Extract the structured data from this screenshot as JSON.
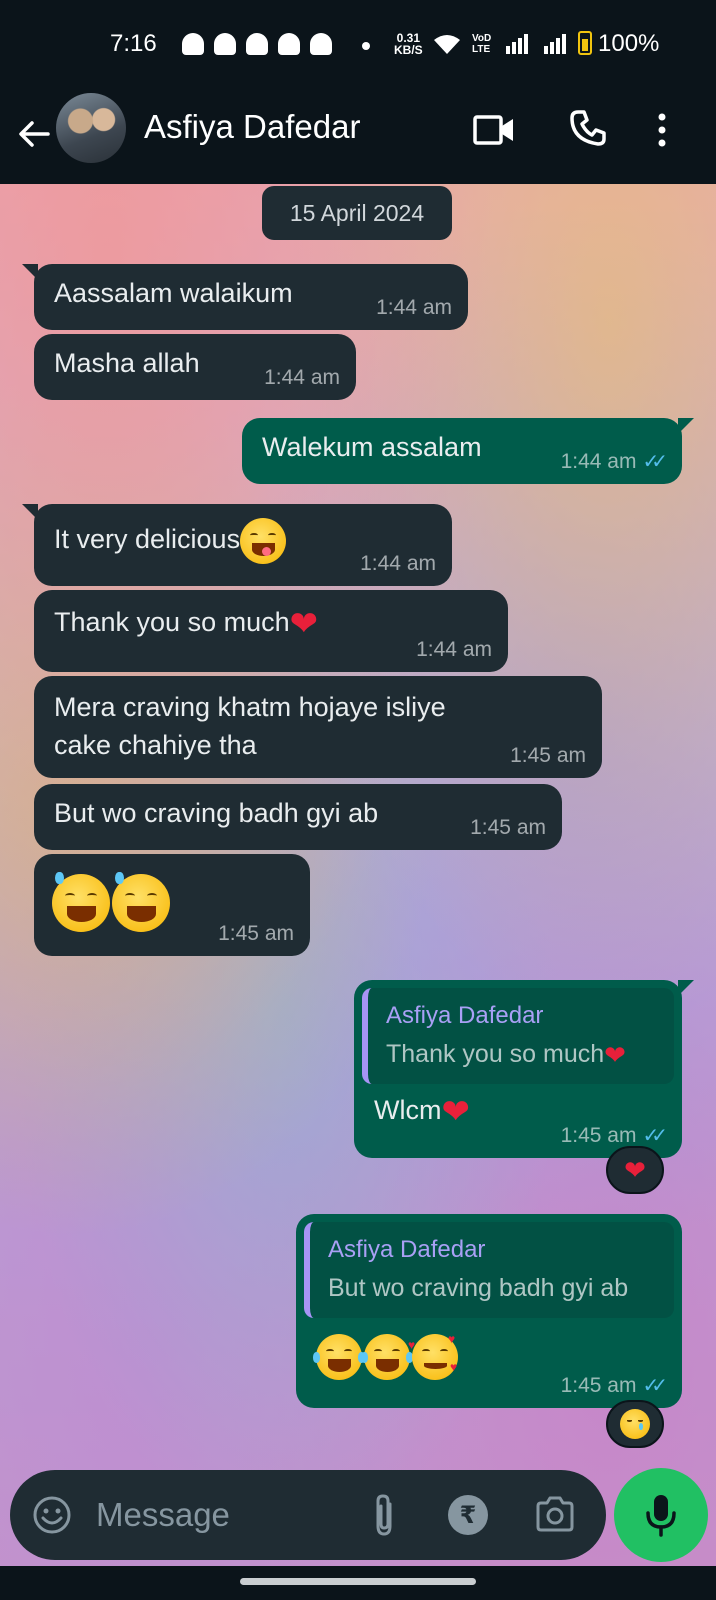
{
  "status_bar": {
    "time": "7:16",
    "net_speed_value": "0.31",
    "net_speed_unit": "KB/S",
    "volte_top": "VoD",
    "volte_bottom": "LTE",
    "battery": "100%"
  },
  "header": {
    "contact_name": "Asfiya Dafedar",
    "icons": [
      "back-arrow-icon",
      "avatar",
      "video-call-icon",
      "phone-call-icon",
      "more-vert-icon"
    ]
  },
  "chat": {
    "date": "15 April 2024",
    "messages": [
      {
        "dir": "in",
        "text": "Aassalam walaikum",
        "time": "1:44 am"
      },
      {
        "dir": "in",
        "text": "Masha allah",
        "time": "1:44 am"
      },
      {
        "dir": "out",
        "text": "Walekum assalam",
        "time": "1:44 am",
        "status": "read"
      },
      {
        "dir": "in",
        "text": "It very delicious",
        "emoji": "face-savoring-food",
        "time": "1:44 am"
      },
      {
        "dir": "in",
        "text": "Thank you so much",
        "emoji": "red-heart",
        "time": "1:44 am"
      },
      {
        "dir": "in",
        "text_line1": "Mera craving khatm hojaye isliye",
        "text_line2": "cake chahiye tha",
        "time": "1:45 am"
      },
      {
        "dir": "in",
        "text": "But wo craving badh gyi ab",
        "time": "1:45 am"
      },
      {
        "dir": "in",
        "emoji": "grinning-face-with-sweat x2",
        "time": "1:45 am"
      },
      {
        "dir": "out",
        "quote_name": "Asfiya Dafedar",
        "quote_text": "Thank you so much",
        "text": "Wlcm",
        "emoji": "red-heart",
        "time": "1:45 am",
        "status": "read",
        "reaction": "red-heart"
      },
      {
        "dir": "out",
        "quote_name": "Asfiya Dafedar",
        "quote_text": "But wo craving badh gyi ab",
        "emoji": "tears-of-joy x2, smiling-face-with-hearts",
        "time": "1:45 am",
        "status": "read",
        "reaction": "crying-face"
      }
    ]
  },
  "input": {
    "placeholder": "Message"
  },
  "colors": {
    "incoming_bubble": "#1f2c33",
    "outgoing_bubble": "#005c4b",
    "read_ticks": "#53bdeb",
    "mic_button": "#21c063",
    "quote_accent": "#a794f5"
  }
}
